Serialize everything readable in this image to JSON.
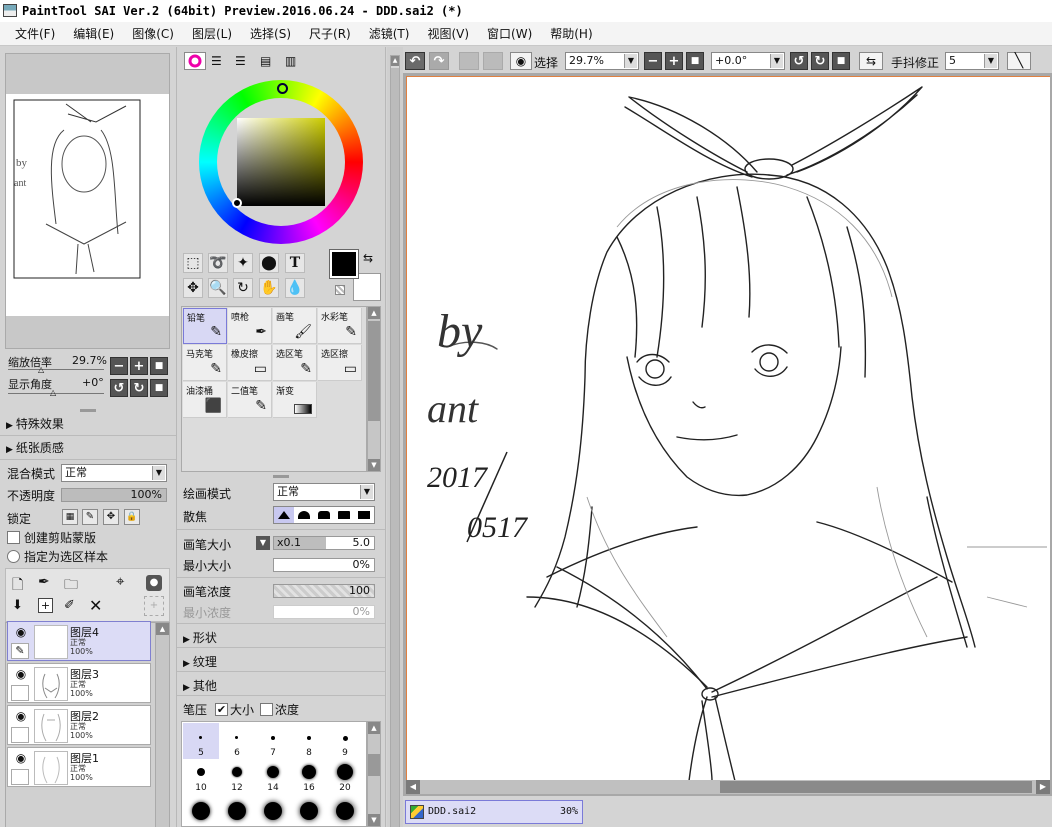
{
  "window": {
    "title": "PaintTool SAI Ver.2 (64bit) Preview.2016.06.24 - DDD.sai2 (*)"
  },
  "menu": [
    "文件(F)",
    "编辑(E)",
    "图像(C)",
    "图层(L)",
    "选择(S)",
    "尺子(R)",
    "滤镜(T)",
    "视图(V)",
    "窗口(W)",
    "帮助(H)"
  ],
  "navigator": {
    "zoom_label": "缩放倍率",
    "zoom_value": "29.7%",
    "angle_label": "显示角度",
    "angle_value": "+0°",
    "minus": "−",
    "plus": "+",
    "stop": "■",
    "rot_ccw": "↺",
    "rot_cw": "↻"
  },
  "layer_panel": {
    "effects": "特殊效果",
    "paper": "纸张质感",
    "blend_label": "混合模式",
    "blend_value": "正常",
    "opacity_label": "不透明度",
    "opacity_value": "100%",
    "lock_label": "锁定",
    "clip_label": "创建剪贴蒙版",
    "sample_label": "指定为选区样本",
    "layers": [
      {
        "name": "图层4",
        "mode": "正常",
        "opacity": "100%"
      },
      {
        "name": "图层3",
        "mode": "正常",
        "opacity": "100%"
      },
      {
        "name": "图层2",
        "mode": "正常",
        "opacity": "100%"
      },
      {
        "name": "图层1",
        "mode": "正常",
        "opacity": "100%"
      }
    ],
    "delete": "✕",
    "eye": "◉",
    "pen": "✎"
  },
  "tools": {
    "text_tool": "T",
    "swap": "⇆"
  },
  "brushes": [
    {
      "name": "铅笔",
      "icon": "✎"
    },
    {
      "name": "喷枪",
      "icon": "✒"
    },
    {
      "name": "画笔",
      "icon": "🖌"
    },
    {
      "name": "水彩笔",
      "icon": "✎"
    },
    {
      "name": "马克笔",
      "icon": "✎"
    },
    {
      "name": "橡皮擦",
      "icon": "▭"
    },
    {
      "name": "选区笔",
      "icon": "✎"
    },
    {
      "name": "选区擦",
      "icon": "▭"
    },
    {
      "name": "油漆桶",
      "icon": "⬛"
    },
    {
      "name": "二值笔",
      "icon": "✎"
    },
    {
      "name": "渐变",
      "icon": "▬"
    }
  ],
  "brush_settings": {
    "draw_mode_label": "绘画模式",
    "draw_mode_value": "正常",
    "focus_label": "散焦",
    "size_label": "画笔大小",
    "size_mult": "x0.1",
    "size_value": "5.0",
    "min_size_label": "最小大小",
    "min_size_value": "0%",
    "density_label": "画笔浓度",
    "density_value": "100",
    "min_density_label": "最小浓度",
    "min_density_value": "0%",
    "shape": "形状",
    "texture": "纹理",
    "other": "其他",
    "pressure_label": "笔压",
    "pressure_size": "大小",
    "pressure_density": "浓度",
    "sizes_row1": [
      "5",
      "6",
      "7",
      "8",
      "9"
    ],
    "sizes_row2": [
      "10",
      "12",
      "14",
      "16",
      "20"
    ]
  },
  "canvas_toolbar": {
    "select_label": "选择",
    "zoom": "29.7%",
    "angle": "+0.0°",
    "stabilizer_label": "手抖修正",
    "stabilizer_value": "5"
  },
  "status": {
    "doc_name": "DDD.sai2",
    "doc_zoom": "30%"
  },
  "drawing": {
    "sig1": "by",
    "sig2": "ant",
    "date1": "2017",
    "date2": "0517"
  },
  "colors": {
    "accent": "#7a7ad8",
    "selected_bg": "#dcdcf6",
    "panel_bg": "#d4d4d4"
  }
}
